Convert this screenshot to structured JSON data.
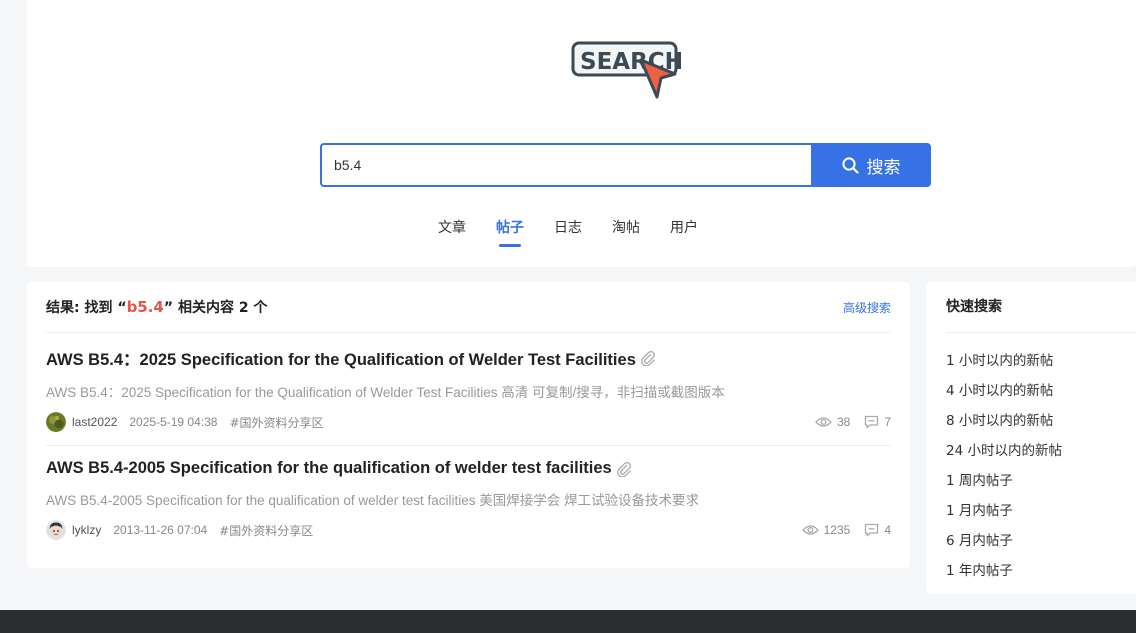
{
  "logo": {
    "text": "SEARCH"
  },
  "search": {
    "value": "b5.4",
    "button_label": "搜索"
  },
  "tabs": [
    {
      "label": "文章",
      "active": false
    },
    {
      "label": "帖子",
      "active": true
    },
    {
      "label": "日志",
      "active": false
    },
    {
      "label": "淘帖",
      "active": false
    },
    {
      "label": "用户",
      "active": false
    }
  ],
  "results": {
    "prefix": "结果: 找到 “",
    "keyword": "b5.4",
    "suffix": "” 相关内容 2 个",
    "advanced_label": "高级搜索",
    "posts": [
      {
        "title": "AWS B5.4：2025 Specification for the Qualification of Welder Test Facilities",
        "description": "AWS B5.4：2025 Specification for the Qualification of Welder Test Facilities 高清 可复制/搜寻，非扫描或截图版本",
        "author": "last2022",
        "date": "2025-5-19 04:38",
        "forum": "#国外资料分享区",
        "views": "38",
        "replies": "7"
      },
      {
        "title": "AWS B5.4-2005 Specification for the qualification of welder test facilities",
        "description": "AWS B5.4-2005 Specification for the qualification of welder test facilities 美国焊接学会 焊工试验设备技术要求",
        "author": "lyklzy",
        "date": "2013-11-26 07:04",
        "forum": "#国外资料分享区",
        "views": "1235",
        "replies": "4"
      }
    ]
  },
  "quick_search": {
    "title": "快速搜索",
    "items": [
      "1 小时以内的新帖",
      "4 小时以内的新帖",
      "8 小时以内的新帖",
      "24 小时以内的新帖",
      "1 周内帖子",
      "1 月内帖子",
      "6 月内帖子",
      "1 年内帖子"
    ]
  },
  "colors": {
    "accent": "#3672e6",
    "keyword": "#e4554a",
    "footer": "#2b2e31"
  }
}
